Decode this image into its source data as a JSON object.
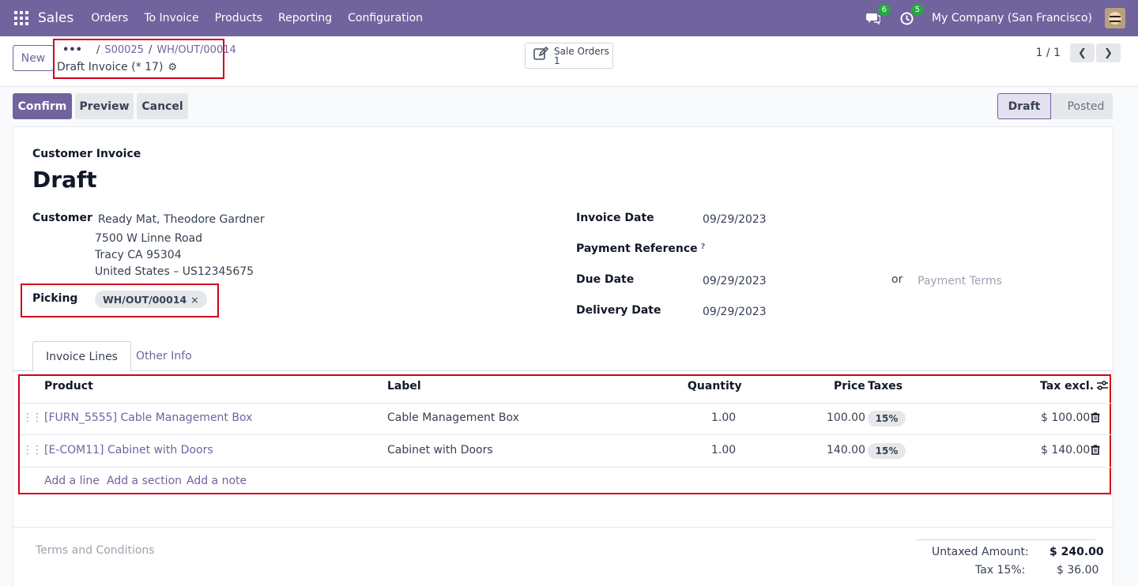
{
  "navbar": {
    "brand": "Sales",
    "menu": [
      "Orders",
      "To Invoice",
      "Products",
      "Reporting",
      "Configuration"
    ],
    "messages_count": "6",
    "activities_count": "5",
    "company": "My Company (San Francisco)"
  },
  "control": {
    "new_label": "New",
    "breadcrumb": [
      "S00025",
      "WH/OUT/00014"
    ],
    "record_title": "Draft Invoice (* 17)",
    "smart_button": {
      "label": "Sale Orders",
      "count": "1"
    },
    "pager": "1 / 1"
  },
  "actions": {
    "confirm": "Confirm",
    "preview": "Preview",
    "cancel": "Cancel",
    "stages": [
      "Draft",
      "Posted"
    ]
  },
  "invoice": {
    "type": "Customer Invoice",
    "state": "Draft",
    "customer_label": "Customer",
    "customer_name": "Ready Mat, Theodore Gardner",
    "address": [
      "7500 W Linne Road",
      "Tracy CA 95304",
      "United States – US12345675"
    ],
    "picking_label": "Picking",
    "picking_value": "WH/OUT/00014",
    "invoice_date_label": "Invoice Date",
    "invoice_date": "09/29/2023",
    "payment_ref_label": "Payment Reference",
    "due_date_label": "Due Date",
    "due_date": "09/29/2023",
    "or_text": "or",
    "payment_terms_placeholder": "Payment Terms",
    "delivery_date_label": "Delivery Date",
    "delivery_date": "09/29/2023"
  },
  "tabs": [
    "Invoice Lines",
    "Other Info"
  ],
  "lines": {
    "headers": {
      "product": "Product",
      "label": "Label",
      "quantity": "Quantity",
      "price": "Price",
      "taxes": "Taxes",
      "tax_excl": "Tax excl."
    },
    "rows": [
      {
        "product": "[FURN_5555] Cable Management Box",
        "label": "Cable Management Box",
        "quantity": "1.00",
        "price": "100.00",
        "tax": "15%",
        "subtotal": "$ 100.00"
      },
      {
        "product": "[E-COM11] Cabinet with Doors",
        "label": "Cabinet with Doors",
        "quantity": "1.00",
        "price": "140.00",
        "tax": "15%",
        "subtotal": "$ 140.00"
      }
    ],
    "add_line": "Add a line",
    "add_section": "Add a section",
    "add_note": "Add a note"
  },
  "footer": {
    "terms_placeholder": "Terms and Conditions",
    "untaxed_label": "Untaxed Amount:",
    "untaxed_value": "$ 240.00",
    "tax_label": "Tax 15%:",
    "tax_value": "$ 36.00"
  },
  "colors": {
    "brand": "#71639e",
    "highlight": "#d0021b"
  }
}
